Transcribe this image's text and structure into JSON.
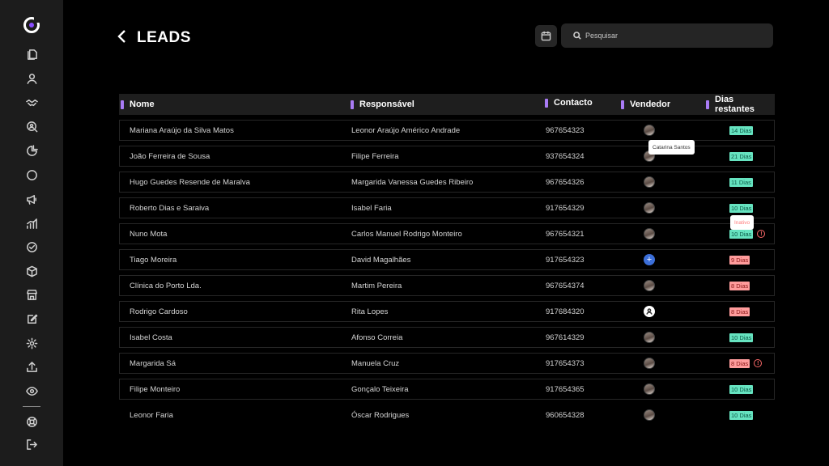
{
  "page": {
    "title": "LEADS"
  },
  "search": {
    "placeholder": "Pesquisar"
  },
  "sidebar": {
    "icons": [
      "logo-icon",
      "documents-icon",
      "user-icon",
      "handshake-icon",
      "search-person-icon",
      "pie-chart-icon",
      "circle-icon",
      "megaphone-icon",
      "bar-chart-icon",
      "check-circle-icon",
      "box-icon",
      "store-icon",
      "edit-icon",
      "settings-icon",
      "upload-icon",
      "eye-icon",
      "help-icon",
      "logout-icon"
    ]
  },
  "table": {
    "headers": {
      "nome": "Nome",
      "responsavel": "Responsável",
      "contacto": "Contacto",
      "vendedor": "Vendedor",
      "dias": "Dias restantes"
    },
    "rows": [
      {
        "nome": "Mariana Araújo da Silva Matos",
        "responsavel": "Leonor Araújo Américo Andrade",
        "contacto": "967654323",
        "vendedor": "avatar",
        "dias": "14 Dias",
        "status": "green"
      },
      {
        "nome": "João Ferreira  de Sousa",
        "responsavel": "Filipe Ferreira",
        "contacto": "937654324",
        "vendedor": "avatar",
        "dias": "21 Dias",
        "status": "green"
      },
      {
        "nome": "Hugo Guedes Resende de Maralva",
        "responsavel": "Margarida Vanessa Guedes Ribeiro",
        "contacto": "967654326",
        "vendedor": "avatar",
        "dias": "11 Dias",
        "status": "green"
      },
      {
        "nome": "Roberto Dias e Saraiva",
        "responsavel": "Isabel Faria",
        "contacto": "917654329",
        "vendedor": "avatar",
        "dias": "10 Dias",
        "status": "green"
      },
      {
        "nome": "Nuno Mota",
        "responsavel": "Carlos Manuel Rodrigo Monteiro",
        "contacto": "967654321",
        "vendedor": "avatar",
        "dias": "10 Dias",
        "status": "green",
        "warning": true
      },
      {
        "nome": "Tiago Moreira",
        "responsavel": "David Magalhães",
        "contacto": "917654323",
        "vendedor": "add",
        "dias": "9 Dias",
        "status": "red"
      },
      {
        "nome": "Clínica do Porto Lda.",
        "responsavel": "Martim Pereira",
        "contacto": "967654374",
        "vendedor": "avatar",
        "dias": "8 Dias",
        "status": "red"
      },
      {
        "nome": "Rodrigo Cardoso",
        "responsavel": "Rita Lopes",
        "contacto": "917684320",
        "vendedor": "user",
        "dias": "8 Dias",
        "status": "red"
      },
      {
        "nome": "Isabel Costa",
        "responsavel": "Afonso Correia",
        "contacto": "967614329",
        "vendedor": "avatar",
        "dias": "10 Dias",
        "status": "green"
      },
      {
        "nome": "Margarida Sá",
        "responsavel": "Manuela Cruz",
        "contacto": "917654373",
        "vendedor": "avatar",
        "dias": "8 Dias",
        "status": "red",
        "warning": true
      },
      {
        "nome": "Filipe Monteiro",
        "responsavel": "Gonçalo Teixeira",
        "contacto": "917654365",
        "vendedor": "avatar",
        "dias": "10 Dias",
        "status": "green"
      },
      {
        "nome": "Leonor Faria",
        "responsavel": "Óscar Rodrigues",
        "contacto": "960654328",
        "vendedor": "avatar",
        "dias": "10 Dias",
        "status": "green"
      }
    ]
  },
  "tooltips": {
    "vendedor": "Catarina Santos",
    "status": "Inativo"
  },
  "colors": {
    "accent": "#a97bf5",
    "badge_green": "#66e3c0",
    "badge_red": "#ff9c9c",
    "warning": "#ff6a6a"
  }
}
